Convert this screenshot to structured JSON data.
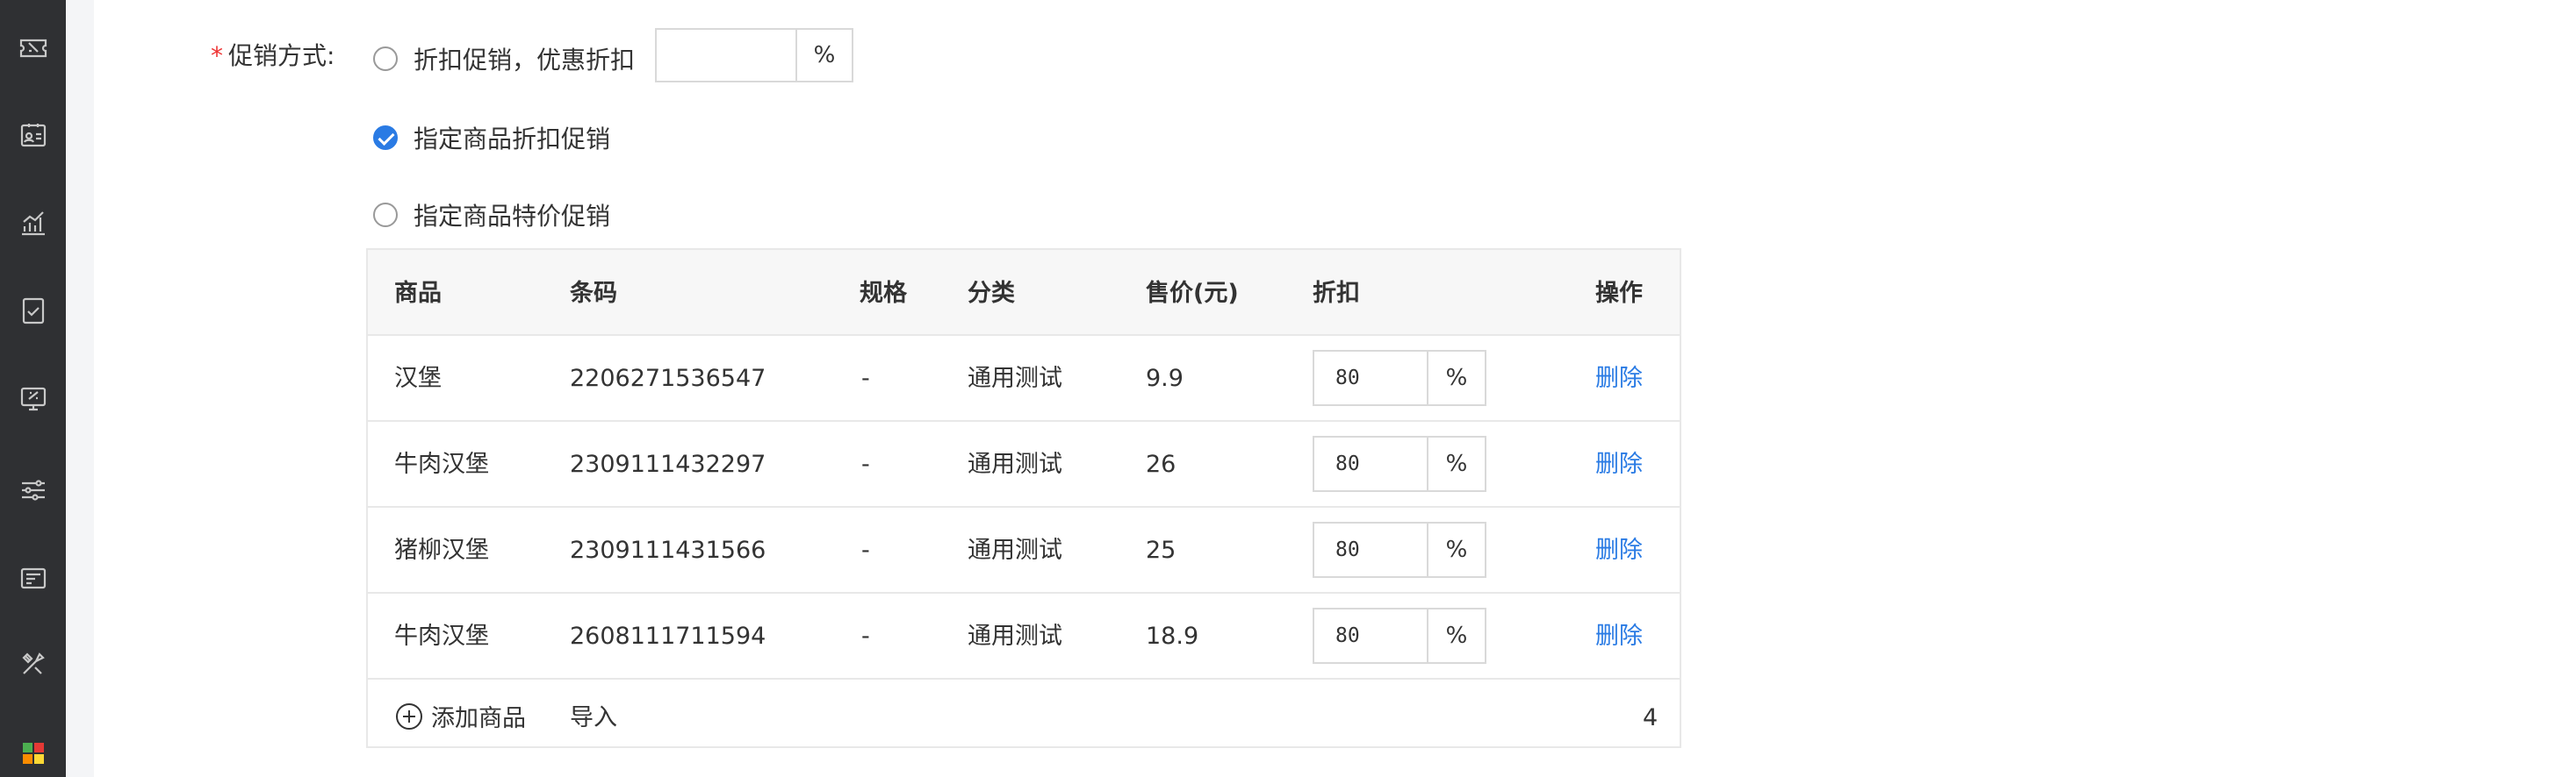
{
  "sidebar": {
    "icons": [
      "ticket-icon",
      "id-card-icon",
      "analytics-icon",
      "checklist-icon",
      "monitor-icon",
      "sliders-icon",
      "card-icon",
      "tools-icon",
      "apps-icon"
    ]
  },
  "form": {
    "promo_label": "促销方式:",
    "required_mark": "*",
    "option_discount": "折扣促销，优惠折扣",
    "discount_suffix": "%",
    "option_product_discount": "指定商品折扣促销",
    "option_special_price": "指定商品特价促销",
    "selected": "指定商品折扣促销"
  },
  "table": {
    "headers": [
      "商品",
      "条码",
      "规格",
      "分类",
      "售价(元)",
      "折扣",
      "操作"
    ],
    "rows": [
      {
        "name": "汉堡",
        "barcode": "2206271536547",
        "spec": "-",
        "category": "通用测试",
        "price": "9.9",
        "discount": "80",
        "suffix": "%",
        "action": "删除"
      },
      {
        "name": "牛肉汉堡",
        "barcode": "2309111432297",
        "spec": "-",
        "category": "通用测试",
        "price": "26",
        "discount": "80",
        "suffix": "%",
        "action": "删除"
      },
      {
        "name": "猪柳汉堡",
        "barcode": "2309111431566",
        "spec": "-",
        "category": "通用测试",
        "price": "25",
        "discount": "80",
        "suffix": "%",
        "action": "删除"
      },
      {
        "name": "牛肉汉堡",
        "barcode": "2608111711594",
        "spec": "-",
        "category": "通用测试",
        "price": "18.9",
        "discount": "80",
        "suffix": "%",
        "action": "删除"
      }
    ],
    "footer": {
      "add_label": "添加商品",
      "import_label": "导入",
      "count": "4"
    }
  },
  "colors": {
    "accent": "#2a7be4",
    "required": "#e33333",
    "sidebar": "#2f3033"
  }
}
